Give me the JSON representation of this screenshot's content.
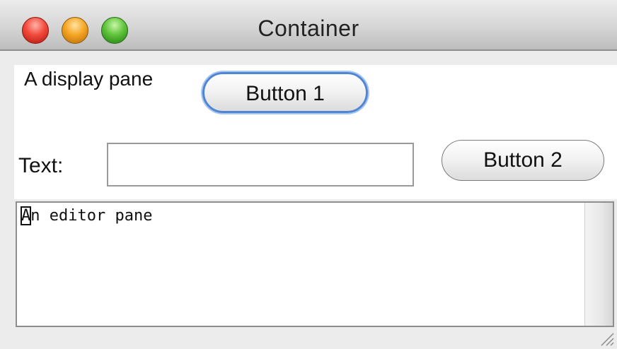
{
  "window": {
    "title": "Container"
  },
  "display_pane": {
    "label": "A display pane"
  },
  "buttons": {
    "button1": "Button 1",
    "button2": "Button 2"
  },
  "text_row": {
    "label": "Text:",
    "value": ""
  },
  "editor_pane": {
    "first_char": "A",
    "rest": "n editor pane"
  },
  "icons": {
    "close": "close-button-icon",
    "minimize": "minimize-button-icon",
    "zoom": "zoom-button-icon",
    "resize": "resize-grip-icon"
  },
  "colors": {
    "close": "#f24a3b",
    "minimize": "#f5a624",
    "zoom": "#5fc43a",
    "focus_ring": "#4f86d3"
  }
}
